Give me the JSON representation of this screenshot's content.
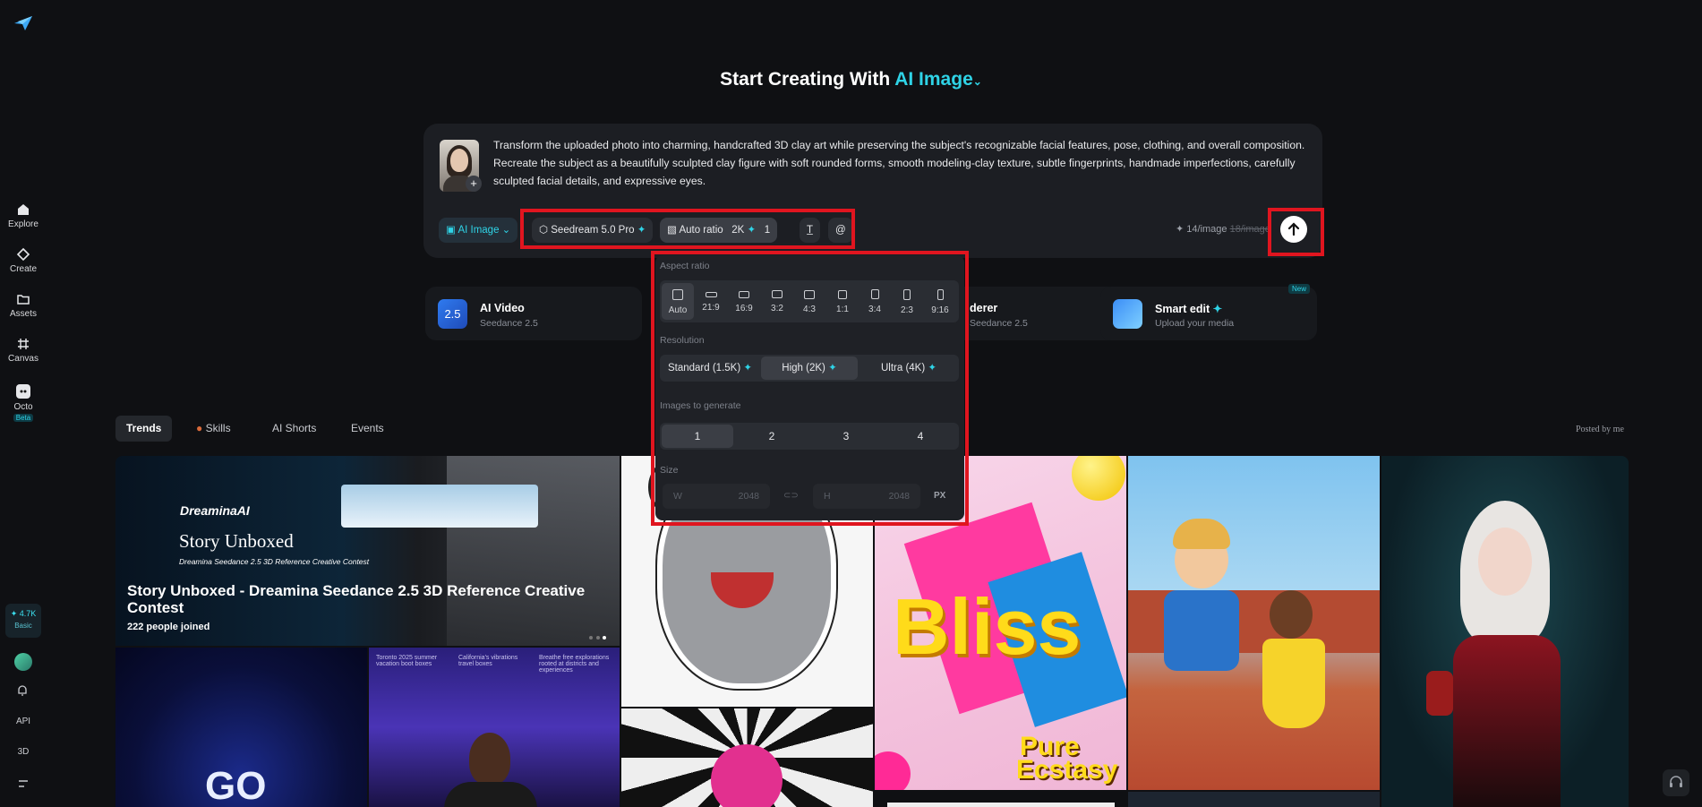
{
  "sidebar": {
    "items": [
      {
        "label": "Explore",
        "icon": "home-icon"
      },
      {
        "label": "Create",
        "icon": "diamond-icon"
      },
      {
        "label": "Assets",
        "icon": "folder-icon"
      },
      {
        "label": "Canvas",
        "icon": "canvas-icon"
      },
      {
        "label": "Octo",
        "icon": "octo-icon",
        "badge": "Beta"
      }
    ],
    "credits": {
      "amount": "4.7K",
      "tier": "Basic"
    },
    "bottom": [
      "API",
      "3D"
    ]
  },
  "headline": {
    "prefix": "Start Creating With",
    "mode": "AI Image"
  },
  "prompt": {
    "text": "Transform the uploaded photo into charming, handcrafted 3D clay art while preserving the subject's recognizable facial features, pose, clothing, and overall composition. Recreate the subject as a beautifully sculpted clay figure with soft rounded forms, smooth modeling-clay texture, subtle fingerprints, handmade imperfections, carefully sculpted facial details, and expressive eyes."
  },
  "toolbar": {
    "mode": "AI Image",
    "model": "Seedream 5.0 Pro",
    "ratio": "Auto ratio",
    "resolution": "2K",
    "count": "1",
    "price": "14/image",
    "old_price": "18/image"
  },
  "features": [
    {
      "title": "AI Video",
      "subtitle": "Seedance 2.5",
      "icon_text": "2.5"
    },
    {
      "title": "derer",
      "subtitle": "Seedance 2.5"
    },
    {
      "title": "Smart edit",
      "subtitle": "Upload your media",
      "badge": "New"
    }
  ],
  "popover": {
    "aspect_label": "Aspect ratio",
    "ratios": [
      "Auto",
      "21:9",
      "16:9",
      "3:2",
      "4:3",
      "1:1",
      "3:4",
      "2:3",
      "9:16"
    ],
    "resolution_label": "Resolution",
    "resolutions": [
      "Standard (1.5K)",
      "High (2K)",
      "Ultra (4K)"
    ],
    "count_label": "Images to generate",
    "counts": [
      "1",
      "2",
      "3",
      "4"
    ],
    "size_label": "Size",
    "w_label": "W",
    "w_value": "2048",
    "h_label": "H",
    "h_value": "2048",
    "unit": "PX"
  },
  "tabs": [
    "Trends",
    "Skills",
    "AI Shorts",
    "Events"
  ],
  "posted_by": "Posted by me",
  "gallery": {
    "banner": {
      "brand": "DreaminaAI",
      "headline": "Story Unboxed",
      "subline": "Dreamina Seedance 2.5 3D Reference Creative Contest",
      "title": "Story Unboxed - Dreamina Seedance 2.5 3D Reference Creative Contest",
      "joined": "222",
      "joined_suffix": "people joined"
    },
    "go_text": "GO",
    "bliss_text": "Bliss",
    "pure_text": "Pure",
    "ecstasy_text": "Ecstasy",
    "small_captions": [
      "Toronto 2025 summer vacation boot boxes",
      "California's vibrations travel boxes",
      "Breathe free explorations rooted at districts and experiences"
    ]
  },
  "colors": {
    "accent": "#2fd3e6",
    "highlight": "#e0151f",
    "background": "#0f1013"
  }
}
